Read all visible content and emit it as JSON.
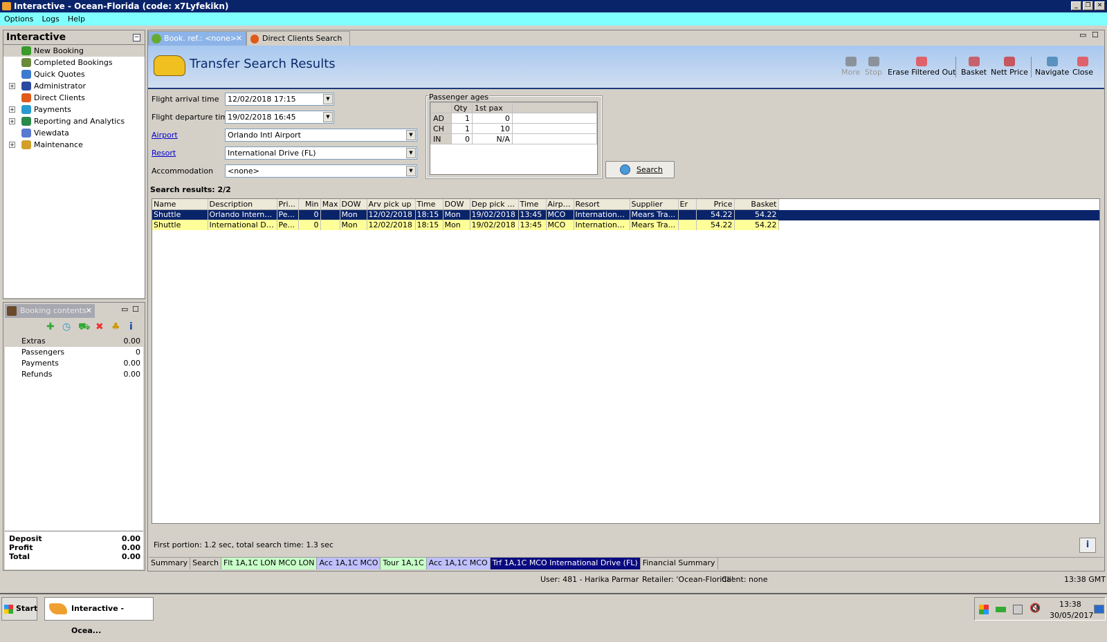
{
  "window": {
    "title": "Interactive - Ocean-Florida (code: x7Lyfekikn)"
  },
  "menu": [
    "Options",
    "Logs",
    "Help"
  ],
  "sidebar": {
    "title": "Interactive",
    "items": [
      {
        "label": "New Booking",
        "expandable": false,
        "color": "#3a9a2a"
      },
      {
        "label": "Completed Bookings",
        "expandable": false,
        "color": "#6a8a3a"
      },
      {
        "label": "Quick Quotes",
        "expandable": false,
        "color": "#3a7ad0"
      },
      {
        "label": "Administrator",
        "expandable": true,
        "color": "#2a4aa0"
      },
      {
        "label": "Direct Clients",
        "expandable": false,
        "color": "#e05a1a"
      },
      {
        "label": "Payments",
        "expandable": true,
        "color": "#2a9ad0"
      },
      {
        "label": "Reporting and Analytics",
        "expandable": true,
        "color": "#2a8a4a"
      },
      {
        "label": "Viewdata",
        "expandable": false,
        "color": "#5a7ad0"
      },
      {
        "label": "Maintenance",
        "expandable": true,
        "color": "#d0a02a"
      }
    ]
  },
  "booking_contents": {
    "tab": "Booking contents",
    "rows": [
      {
        "label": "Extras",
        "value": "0.00"
      },
      {
        "label": "Passengers",
        "value": "0"
      },
      {
        "label": "Payments",
        "value": "0.00"
      },
      {
        "label": "Refunds",
        "value": "0.00"
      }
    ],
    "totals": [
      {
        "label": "Deposit",
        "value": "0.00"
      },
      {
        "label": "Profit",
        "value": "0.00"
      },
      {
        "label": "Total",
        "value": "0.00"
      }
    ]
  },
  "tabs": [
    {
      "label": "Book. ref.: <none>",
      "active": true
    },
    {
      "label": "Direct Clients Search",
      "active": false
    }
  ],
  "header": {
    "title": "Transfer Search Results"
  },
  "toolbar": [
    {
      "label": "More",
      "disabled": true
    },
    {
      "label": "Stop",
      "disabled": true
    },
    {
      "label": "Erase Filtered Out"
    },
    {
      "label": "Basket"
    },
    {
      "label": "Nett Price"
    },
    {
      "label": "Navigate"
    },
    {
      "label": "Close"
    }
  ],
  "form": {
    "arrival_label": "Flight arrival time",
    "arrival": "12/02/2018 17:15",
    "departure_label": "Flight departure time",
    "departure": "19/02/2018 16:45",
    "airport_label": "Airport",
    "airport": "Orlando Intl Airport",
    "resort_label": "Resort",
    "resort": "International Drive (FL)",
    "accommodation_label": "Accommodation",
    "accommodation": "<none>"
  },
  "passenger_ages": {
    "title": "Passenger ages",
    "headers": [
      "",
      "Qty",
      "1st pax"
    ],
    "rows": [
      [
        "AD",
        "1",
        "0"
      ],
      [
        "CH",
        "1",
        "10"
      ],
      [
        "IN",
        "0",
        "N/A"
      ]
    ]
  },
  "search_button": "Search",
  "results": {
    "label": "Search results: 2/2",
    "columns": [
      "Name",
      "Description",
      "Pri...",
      "Min",
      "Max",
      "DOW",
      "Arv pick up",
      "Time",
      "DOW",
      "Dep pick up",
      "Time",
      "Airport",
      "Resort",
      "Supplier",
      "Er",
      "Price",
      "Basket"
    ],
    "rows": [
      [
        "Shuttle",
        "Orlando Internat...",
        "Pe...",
        "0",
        "",
        "Mon",
        "12/02/2018",
        "18:15",
        "Mon",
        "19/02/2018",
        "13:45",
        "MCO",
        "International...",
        "Mears Tra...",
        "",
        "54.22",
        "54.22"
      ],
      [
        "Shuttle",
        "International Dri...",
        "Pe...",
        "0",
        "",
        "Mon",
        "12/02/2018",
        "18:15",
        "Mon",
        "19/02/2018",
        "13:45",
        "MCO",
        "International...",
        "Mears Tra...",
        "",
        "54.22",
        "54.22"
      ]
    ]
  },
  "search_time": "First portion: 1.2 sec, total search time: 1.3 sec",
  "bottom_tabs": [
    {
      "label": "Summary",
      "color": "#d4d0c8"
    },
    {
      "label": "Search",
      "color": "#d4d0c8"
    },
    {
      "label": "Flt 1A,1C LON MCO LON",
      "color": "#c8ffc8"
    },
    {
      "label": "Acc 1A,1C MCO",
      "color": "#c0c0ff"
    },
    {
      "label": "Tour 1A,1C",
      "color": "#c8ffc8"
    },
    {
      "label": "Acc 1A,1C MCO",
      "color": "#c0c0ff"
    },
    {
      "label": "Trf 1A,1C MCO International Drive (FL)",
      "color": "#0a0a80",
      "active": true
    },
    {
      "label": "Financial Summary",
      "color": "#d4d0c8"
    }
  ],
  "status": {
    "user": "User: 481 - Harika Parmar",
    "retailer": "Retailer: 'Ocean-Florida'",
    "client": "Client: none",
    "time": "13:38 GMT"
  },
  "taskbar": {
    "start": "Start",
    "app": "Interactive - Ocea...",
    "clock_time": "13:38",
    "clock_date": "30/05/2017"
  }
}
